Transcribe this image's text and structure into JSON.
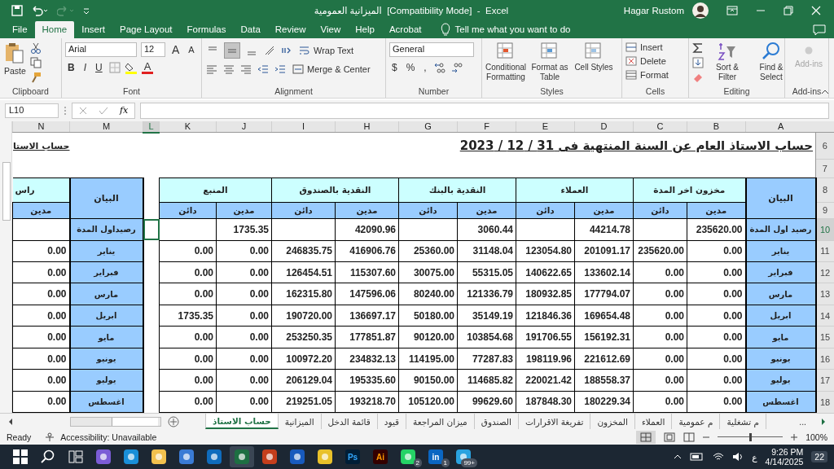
{
  "title_bar": {
    "title": "الميزانية العمومية  [Compatibility Mode]  -  Excel",
    "user": "Hagar Rustom"
  },
  "menu_tabs": [
    {
      "label": "File",
      "selected": false
    },
    {
      "label": "Home",
      "selected": true
    },
    {
      "label": "Insert",
      "selected": false
    },
    {
      "label": "Page Layout",
      "selected": false
    },
    {
      "label": "Formulas",
      "selected": false
    },
    {
      "label": "Data",
      "selected": false
    },
    {
      "label": "Review",
      "selected": false
    },
    {
      "label": "View",
      "selected": false
    },
    {
      "label": "Help",
      "selected": false
    },
    {
      "label": "Acrobat",
      "selected": false
    }
  ],
  "tell_me": "Tell me what you want to do",
  "ribbon": {
    "clipboard": {
      "paste": "Paste",
      "label": "Clipboard"
    },
    "font": {
      "name": "Arial",
      "size": "12",
      "resize": [
        "A",
        "A"
      ],
      "styles": [
        "B",
        "I",
        "U"
      ],
      "color_letter": "A",
      "label": "Font"
    },
    "alignment": {
      "vertical": [
        {
          "selected": false
        },
        {
          "selected": true
        },
        {
          "selected": false
        }
      ],
      "wrap": "Wrap Text",
      "merge": "Merge & Center",
      "label": "Alignment"
    },
    "number": {
      "format": "General",
      "symbols": [
        "$",
        "%",
        ","
      ],
      "label": "Number"
    },
    "styles": {
      "buttons": [
        "Conditional Formatting",
        "Format as Table",
        "Cell Styles"
      ],
      "label": "Styles"
    },
    "cells": {
      "buttons": [
        "Insert",
        "Delete",
        "Format"
      ],
      "label": "Cells"
    },
    "editing": {
      "buttons": [
        "Sort & Filter",
        "Find & Select"
      ],
      "label": "Editing"
    },
    "addins": {
      "button": "Add-ins",
      "label": "Add-ins",
      "disabled": true
    }
  },
  "formula_bar": {
    "name_box": "L10",
    "fx": "fx"
  },
  "sheet": {
    "columns": [
      {
        "letter": "N",
        "selected": false
      },
      {
        "letter": "M",
        "selected": false
      },
      {
        "letter": "L",
        "selected": true
      },
      {
        "letter": "K",
        "selected": false
      },
      {
        "letter": "J",
        "selected": false
      },
      {
        "letter": "I",
        "selected": false
      },
      {
        "letter": "H",
        "selected": false
      },
      {
        "letter": "G",
        "selected": false
      },
      {
        "letter": "F",
        "selected": false
      },
      {
        "letter": "E",
        "selected": false
      },
      {
        "letter": "D",
        "selected": false
      },
      {
        "letter": "C",
        "selected": false
      },
      {
        "letter": "B",
        "selected": false
      },
      {
        "letter": "A",
        "selected": false
      }
    ],
    "header_rows": [
      {
        "number": "6",
        "selected": false
      },
      {
        "number": "7",
        "selected": false
      },
      {
        "number": "8",
        "selected": false
      },
      {
        "number": "9",
        "selected": false
      }
    ],
    "side_title": "حساب الاستا",
    "title": "حساب الاستاذ العام عن السنة المنتهية فى 31 / 12 / 2023",
    "side_group": "راس",
    "side_sub": "مدين",
    "side_label_header": "البيان",
    "groups": [
      {
        "label": "مخزون اخر المدة",
        "sub": [
          "مدين",
          "دائن"
        ]
      },
      {
        "label": "العملاء",
        "sub": [
          "مدين",
          "دائن"
        ]
      },
      {
        "label": "النقدية بالبنك",
        "sub": [
          "مدين",
          "دائن"
        ]
      },
      {
        "label": "النقدية بالصندوق",
        "sub": [
          "مدين",
          "دائن"
        ]
      },
      {
        "label": "المنبع",
        "sub": [
          "مدين",
          "دائن"
        ]
      }
    ],
    "label_header": "البيان",
    "rows": [
      {
        "number": "10",
        "selected": true,
        "cells": [
          {
            "kind": "value"
          },
          {
            "kind": "label",
            "text": "رصيداول المدة"
          },
          {
            "kind": "gap"
          },
          {
            "kind": "value"
          },
          {
            "kind": "value",
            "text": "1735.35"
          },
          {
            "kind": "value"
          },
          {
            "kind": "value",
            "text": "42090.96"
          },
          {
            "kind": "value"
          },
          {
            "kind": "value",
            "text": "3060.44"
          },
          {
            "kind": "value"
          },
          {
            "kind": "value",
            "text": "44214.78"
          },
          {
            "kind": "value"
          },
          {
            "kind": "value",
            "text": "235620.00"
          },
          {
            "kind": "label",
            "text": "رصيد اول المدة"
          }
        ]
      },
      {
        "number": "11",
        "selected": false,
        "cells": [
          {
            "kind": "value",
            "text": "0.00"
          },
          {
            "kind": "label",
            "text": "يناير"
          },
          {
            "kind": "gap"
          },
          {
            "kind": "value",
            "text": "0.00"
          },
          {
            "kind": "value",
            "text": "0.00"
          },
          {
            "kind": "value",
            "text": "246835.75"
          },
          {
            "kind": "value",
            "text": "416906.76"
          },
          {
            "kind": "value",
            "text": "25360.00"
          },
          {
            "kind": "value",
            "text": "31148.04"
          },
          {
            "kind": "value",
            "text": "123054.80"
          },
          {
            "kind": "value",
            "text": "201091.17"
          },
          {
            "kind": "value",
            "text": "235620.00"
          },
          {
            "kind": "value",
            "text": "0.00"
          },
          {
            "kind": "label",
            "text": "يناير"
          }
        ]
      },
      {
        "number": "12",
        "selected": false,
        "cells": [
          {
            "kind": "value",
            "text": "0.00"
          },
          {
            "kind": "label",
            "text": "فبراير"
          },
          {
            "kind": "gap"
          },
          {
            "kind": "value",
            "text": "0.00"
          },
          {
            "kind": "value",
            "text": "0.00"
          },
          {
            "kind": "value",
            "text": "126454.51"
          },
          {
            "kind": "value",
            "text": "115307.60"
          },
          {
            "kind": "value",
            "text": "30075.00"
          },
          {
            "kind": "value",
            "text": "55315.05"
          },
          {
            "kind": "value",
            "text": "140622.65"
          },
          {
            "kind": "value",
            "text": "133602.14"
          },
          {
            "kind": "value",
            "text": "0.00"
          },
          {
            "kind": "value",
            "text": "0.00"
          },
          {
            "kind": "label",
            "text": "فبراير"
          }
        ]
      },
      {
        "number": "13",
        "selected": false,
        "cells": [
          {
            "kind": "value",
            "text": "0.00"
          },
          {
            "kind": "label",
            "text": "مارس"
          },
          {
            "kind": "gap"
          },
          {
            "kind": "value",
            "text": "0.00"
          },
          {
            "kind": "value",
            "text": "0.00"
          },
          {
            "kind": "value",
            "text": "162315.80"
          },
          {
            "kind": "value",
            "text": "147596.06"
          },
          {
            "kind": "value",
            "text": "80240.00"
          },
          {
            "kind": "value",
            "text": "121336.79"
          },
          {
            "kind": "value",
            "text": "180932.85"
          },
          {
            "kind": "value",
            "text": "177794.07"
          },
          {
            "kind": "value",
            "text": "0.00"
          },
          {
            "kind": "value",
            "text": "0.00"
          },
          {
            "kind": "label",
            "text": "مارس"
          }
        ]
      },
      {
        "number": "14",
        "selected": false,
        "cells": [
          {
            "kind": "value",
            "text": "0.00"
          },
          {
            "kind": "label",
            "text": "ابريل"
          },
          {
            "kind": "gap"
          },
          {
            "kind": "value",
            "text": "1735.35"
          },
          {
            "kind": "value",
            "text": "0.00"
          },
          {
            "kind": "value",
            "text": "190720.00"
          },
          {
            "kind": "value",
            "text": "136697.17"
          },
          {
            "kind": "value",
            "text": "50180.00"
          },
          {
            "kind": "value",
            "text": "35149.19"
          },
          {
            "kind": "value",
            "text": "121846.36"
          },
          {
            "kind": "value",
            "text": "169654.48"
          },
          {
            "kind": "value",
            "text": "0.00"
          },
          {
            "kind": "value",
            "text": "0.00"
          },
          {
            "kind": "label",
            "text": "ابريل"
          }
        ]
      },
      {
        "number": "15",
        "selected": false,
        "cells": [
          {
            "kind": "value",
            "text": "0.00"
          },
          {
            "kind": "label",
            "text": "مايو"
          },
          {
            "kind": "gap"
          },
          {
            "kind": "value",
            "text": "0.00"
          },
          {
            "kind": "value",
            "text": "0.00"
          },
          {
            "kind": "value",
            "text": "253250.35"
          },
          {
            "kind": "value",
            "text": "177851.87"
          },
          {
            "kind": "value",
            "text": "90120.00"
          },
          {
            "kind": "value",
            "text": "103854.68"
          },
          {
            "kind": "value",
            "text": "191706.55"
          },
          {
            "kind": "value",
            "text": "156192.31"
          },
          {
            "kind": "value",
            "text": "0.00"
          },
          {
            "kind": "value",
            "text": "0.00"
          },
          {
            "kind": "label",
            "text": "مايو"
          }
        ]
      },
      {
        "number": "16",
        "selected": false,
        "cells": [
          {
            "kind": "value",
            "text": "0.00"
          },
          {
            "kind": "label",
            "text": "يونيو"
          },
          {
            "kind": "gap"
          },
          {
            "kind": "value",
            "text": "0.00"
          },
          {
            "kind": "value",
            "text": "0.00"
          },
          {
            "kind": "value",
            "text": "100972.20"
          },
          {
            "kind": "value",
            "text": "234832.13"
          },
          {
            "kind": "value",
            "text": "114195.00"
          },
          {
            "kind": "value",
            "text": "77287.83"
          },
          {
            "kind": "value",
            "text": "198119.96"
          },
          {
            "kind": "value",
            "text": "221612.69"
          },
          {
            "kind": "value",
            "text": "0.00"
          },
          {
            "kind": "value",
            "text": "0.00"
          },
          {
            "kind": "label",
            "text": "يونيو"
          }
        ]
      },
      {
        "number": "17",
        "selected": false,
        "cells": [
          {
            "kind": "value",
            "text": "0.00"
          },
          {
            "kind": "label",
            "text": "يوليو"
          },
          {
            "kind": "gap"
          },
          {
            "kind": "value",
            "text": "0.00"
          },
          {
            "kind": "value",
            "text": "0.00"
          },
          {
            "kind": "value",
            "text": "206129.04"
          },
          {
            "kind": "value",
            "text": "195335.60"
          },
          {
            "kind": "value",
            "text": "90150.00"
          },
          {
            "kind": "value",
            "text": "114685.82"
          },
          {
            "kind": "value",
            "text": "220021.42"
          },
          {
            "kind": "value",
            "text": "188558.37"
          },
          {
            "kind": "value",
            "text": "0.00"
          },
          {
            "kind": "value",
            "text": "0.00"
          },
          {
            "kind": "label",
            "text": "يوليو"
          }
        ]
      },
      {
        "number": "18",
        "selected": false,
        "cells": [
          {
            "kind": "value",
            "text": "0.00"
          },
          {
            "kind": "label",
            "text": "اغسطس"
          },
          {
            "kind": "gap"
          },
          {
            "kind": "value",
            "text": "0.00"
          },
          {
            "kind": "value",
            "text": "0.00"
          },
          {
            "kind": "value",
            "text": "219251.05"
          },
          {
            "kind": "value",
            "text": "193218.70"
          },
          {
            "kind": "value",
            "text": "105120.00"
          },
          {
            "kind": "value",
            "text": "99629.60"
          },
          {
            "kind": "value",
            "text": "187848.30"
          },
          {
            "kind": "value",
            "text": "180229.34"
          },
          {
            "kind": "value",
            "text": "0.00"
          },
          {
            "kind": "value",
            "text": "0.00"
          },
          {
            "kind": "label",
            "text": "اغسطس"
          }
        ]
      }
    ]
  },
  "sheet_tabs": [
    {
      "label": "م تشغلية",
      "selected": false
    },
    {
      "label": "م عمومية",
      "selected": false
    },
    {
      "label": "العملاء",
      "selected": false
    },
    {
      "label": "المخزون",
      "selected": false
    },
    {
      "label": "تفريغة الاقرارات",
      "selected": false
    },
    {
      "label": "الصندوق",
      "selected": false
    },
    {
      "label": "ميزان المراجعة",
      "selected": false
    },
    {
      "label": "قيود",
      "selected": false
    },
    {
      "label": "قائمة الدخل",
      "selected": false
    },
    {
      "label": "الميزانية",
      "selected": false
    },
    {
      "label": "حساب الاستاذ",
      "selected": true
    }
  ],
  "more_tabs": "...",
  "status_bar": {
    "status": "Ready",
    "accessibility": "Accessibility: Unavailable",
    "zoom": "100%",
    "level": 0.5
  },
  "taskbar": {
    "apps": [
      {
        "kind": "start",
        "selected": false
      },
      {
        "kind": "search",
        "selected": false
      },
      {
        "kind": "taskview",
        "selected": false
      },
      {
        "kind": "copilot",
        "selected": false
      },
      {
        "kind": "edge",
        "selected": false
      },
      {
        "kind": "files",
        "selected": false
      },
      {
        "kind": "store",
        "selected": false
      },
      {
        "kind": "outlook",
        "selected": false
      },
      {
        "kind": "excel",
        "selected": true
      },
      {
        "kind": "powerpoint",
        "selected": false
      },
      {
        "kind": "word",
        "selected": false
      },
      {
        "kind": "chrome",
        "selected": false
      },
      {
        "kind": "ps",
        "glyph": "Ps",
        "selected": false
      },
      {
        "kind": "ai",
        "glyph": "Ai",
        "selected": false
      },
      {
        "kind": "whatsapp",
        "badge": "2",
        "selected": false
      },
      {
        "kind": "linkedin",
        "glyph": "in",
        "badge": "1",
        "selected": false
      },
      {
        "kind": "telegram",
        "badge": "99+",
        "selected": false
      }
    ],
    "language": "ع",
    "time": "9:26 PM",
    "date": "4/14/2025",
    "notifications": "22"
  }
}
